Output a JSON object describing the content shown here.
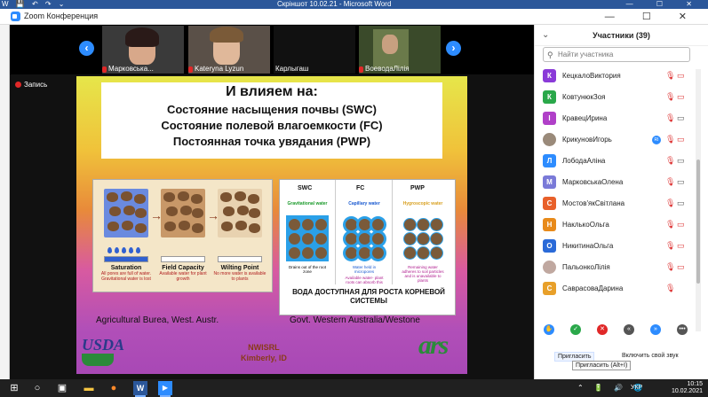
{
  "word": {
    "title": "Скріншот 10.02.21  -  Microsoft Word",
    "quick_icons": "W 💾 ↶ ↷ ⌄",
    "controls": "— ☐ ✕"
  },
  "zoom": {
    "title": "Zoom Конференция",
    "controls": "— ☐ ✕"
  },
  "thumbnails": [
    {
      "label": "Марковська..."
    },
    {
      "label": "Kateryna Lyzun"
    },
    {
      "label": "Карлыгаш"
    },
    {
      "label": "ВоеводаЛілія"
    }
  ],
  "nav": {
    "prev": "‹",
    "next": "›"
  },
  "recording": "Запись",
  "slide": {
    "heading": "И влияем на:",
    "line1": "Состояние насыщения почвы (SWC)",
    "line2": "Состояние полевой влагоемкости (FC)",
    "line3": "Постоянная точка увядания (PWP)",
    "left_panel": {
      "states": [
        {
          "title": "Saturation",
          "desc": "All pores are full of water. Gravitational water is lost"
        },
        {
          "title": "Field Capacity",
          "desc": "Available water for plant growth"
        },
        {
          "title": "Wilting Point",
          "desc": "No more water is available to plants"
        }
      ]
    },
    "right_panel": {
      "columns": [
        {
          "head": "SWC",
          "sub": "Gravitational water",
          "sub_color": "#1a9a2a",
          "note": "Drains out of the root zone"
        },
        {
          "head": "FC",
          "sub": "Capillary water",
          "sub_color": "#1a5ad0",
          "note": "Water held in micropores"
        },
        {
          "head": "PWP",
          "sub": "Hygroscopic water",
          "sub_color": "#d8a020",
          "note": "Remaining water adheres to soil particles and is unavailable to plants"
        }
      ],
      "available_note": "Available water- plant roots can absorb this",
      "caption": "ВОДА ДОСТУПНАЯ ДЛЯ РОСТА КОРНЕВОЙ СИСТЕМЫ"
    },
    "source_left": "Agricultural Burea, West. Austr.",
    "source_right": "Govt. Western Australia/Westone",
    "usda": "USDA",
    "nwisrl": "NWISRL",
    "nwisrl_loc": "Kimberly, ID",
    "ars": "ars"
  },
  "participants": {
    "title": "Участники (39)",
    "search_placeholder": "Найти участника",
    "people": [
      {
        "name": "КецкалоВиктория",
        "initial": "К",
        "color": "#8a3ad8",
        "cam": "off"
      },
      {
        "name": "КовтунюкЗоя",
        "initial": "К",
        "color": "#2aa84a",
        "cam": "off"
      },
      {
        "name": "КравецИрина",
        "initial": "I",
        "color": "#b040c8",
        "cam": "on"
      },
      {
        "name": "КрикуновИгорь",
        "initial": "",
        "color": "#9a8a7a",
        "cam": "off",
        "badge": "RI"
      },
      {
        "name": "ЛободаАліна",
        "initial": "Л",
        "color": "#2d8cff",
        "cam": "on"
      },
      {
        "name": "МарковськаОлена",
        "initial": "М",
        "color": "#7a7ad8",
        "cam": "on"
      },
      {
        "name": "Мостов'якСвітлана",
        "initial": "С",
        "color": "#e8602a",
        "cam": "on"
      },
      {
        "name": "НаклькоОльга",
        "initial": "Н",
        "color": "#e88a1a",
        "cam": "off"
      },
      {
        "name": "НикитинаОльга",
        "initial": "О",
        "color": "#2a6ad8",
        "cam": "off"
      },
      {
        "name": "ПальонкоЛілія",
        "initial": "",
        "color": "#c0a8a0",
        "cam": "off"
      },
      {
        "name": "СаврасоваДарина",
        "initial": "С",
        "color": "#e8a02a",
        "cam": "off"
      }
    ],
    "reactions": [
      "✋",
      "✓",
      "✕",
      "«",
      "»",
      "•••"
    ],
    "invite": "Пригласить",
    "sound_button": "Включить свой звук",
    "invite_tooltip": "Пригласить (Alt+I)"
  },
  "taskbar": {
    "lang": "УКР",
    "time": "10:15",
    "date": "10.02.2021",
    "tray": "⌃ 🔋 🔊 🌐"
  }
}
